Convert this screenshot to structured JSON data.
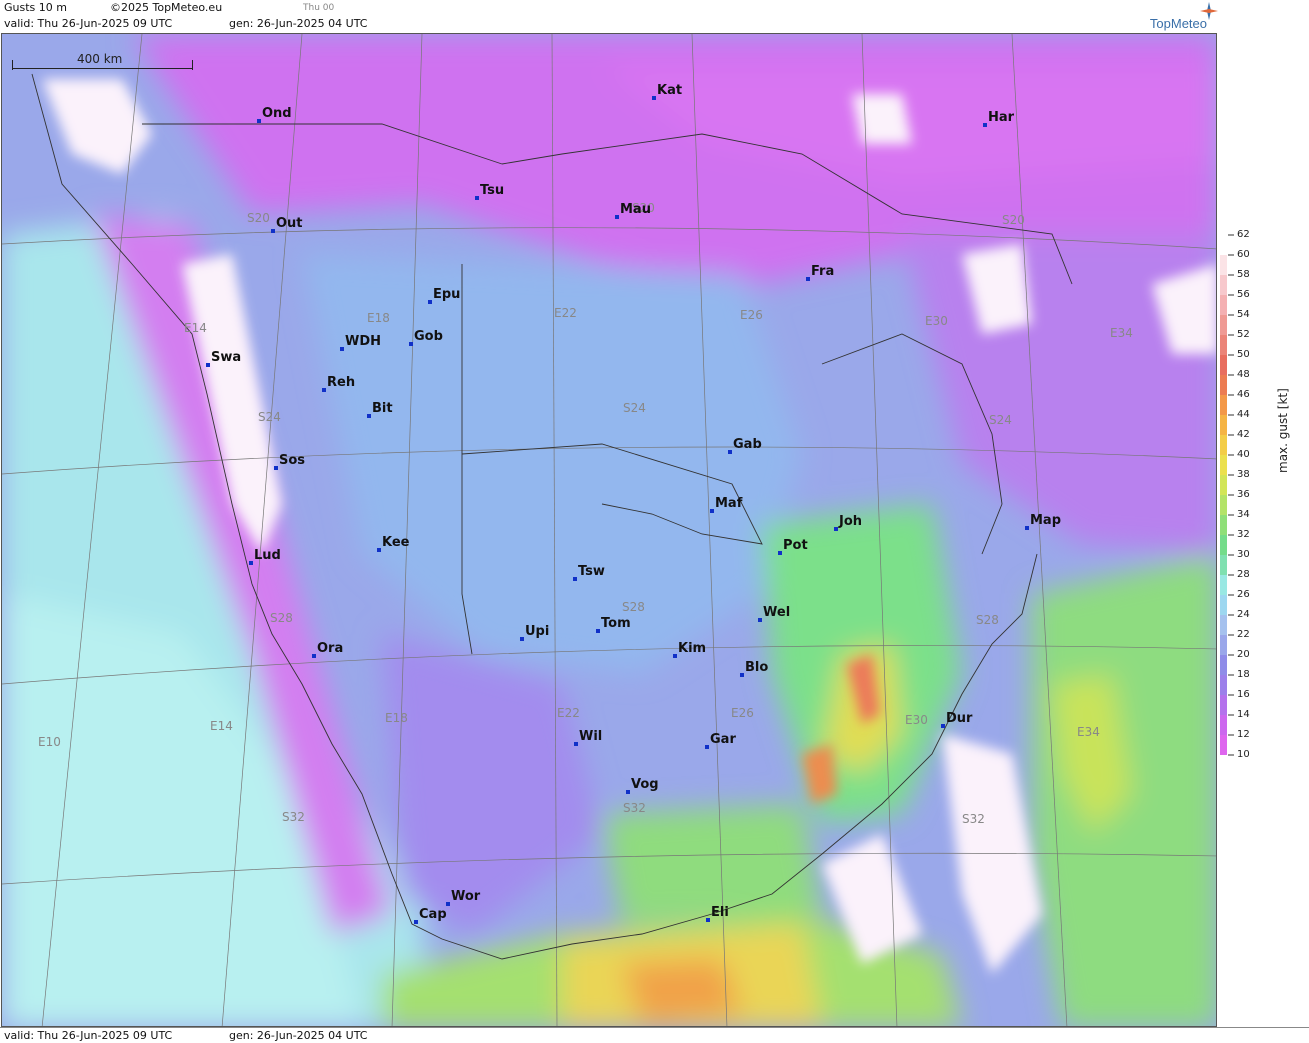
{
  "header": {
    "product": "Gusts 10 m",
    "copyright": "©2025 TopMeteo.eu",
    "run_hint": "Thu 00",
    "valid": "valid:  Thu  26-Jun-2025  09 UTC",
    "gen": "gen: 26-Jun-2025 04 UTC",
    "logo": "TopMeteo"
  },
  "footer": {
    "valid": "valid:  Thu  26-Jun-2025  09 UTC",
    "gen": "gen: 26-Jun-2025 04 UTC"
  },
  "scale_bar": {
    "label": "400 km"
  },
  "cities": [
    {
      "name": "Ond"
    },
    {
      "name": "Kat"
    },
    {
      "name": "Har"
    },
    {
      "name": "Tsu"
    },
    {
      "name": "Out"
    },
    {
      "name": "Mau"
    },
    {
      "name": "Fra"
    },
    {
      "name": "Epu"
    },
    {
      "name": "WDH"
    },
    {
      "name": "Gob"
    },
    {
      "name": "Swa"
    },
    {
      "name": "Reh"
    },
    {
      "name": "Bit"
    },
    {
      "name": "Gab"
    },
    {
      "name": "Sos"
    },
    {
      "name": "Maf"
    },
    {
      "name": "Joh"
    },
    {
      "name": "Map"
    },
    {
      "name": "Pot"
    },
    {
      "name": "Lud"
    },
    {
      "name": "Kee"
    },
    {
      "name": "Tsw"
    },
    {
      "name": "Wel"
    },
    {
      "name": "Tom"
    },
    {
      "name": "Upi"
    },
    {
      "name": "Ora"
    },
    {
      "name": "Kim"
    },
    {
      "name": "Blo"
    },
    {
      "name": "Dur"
    },
    {
      "name": "Wil"
    },
    {
      "name": "Gar"
    },
    {
      "name": "Vog"
    },
    {
      "name": "Wor"
    },
    {
      "name": "Cap"
    },
    {
      "name": "Eli"
    }
  ],
  "grid_labels": [
    {
      "text": "S20"
    },
    {
      "text": "S20"
    },
    {
      "text": "S20"
    },
    {
      "text": "E14"
    },
    {
      "text": "E18"
    },
    {
      "text": "E22"
    },
    {
      "text": "E26"
    },
    {
      "text": "E30"
    },
    {
      "text": "E34"
    },
    {
      "text": "S24"
    },
    {
      "text": "S24"
    },
    {
      "text": "S24"
    },
    {
      "text": "S28"
    },
    {
      "text": "S28"
    },
    {
      "text": "S28"
    },
    {
      "text": "E10"
    },
    {
      "text": "E14"
    },
    {
      "text": "E18"
    },
    {
      "text": "E22"
    },
    {
      "text": "E26"
    },
    {
      "text": "E30"
    },
    {
      "text": "E34"
    },
    {
      "text": "S32"
    },
    {
      "text": "S32"
    },
    {
      "text": "S32"
    }
  ],
  "legend": {
    "title": "max. gust  [kt]",
    "ticks": [
      "62",
      "60",
      "58",
      "56",
      "54",
      "52",
      "50",
      "48",
      "46",
      "44",
      "42",
      "40",
      "38",
      "36",
      "34",
      "32",
      "30",
      "28",
      "26",
      "24",
      "22",
      "20",
      "18",
      "16",
      "14",
      "12",
      "10"
    ],
    "colors": [
      "#ffffff",
      "#fbe3e6",
      "#f7c8cc",
      "#f4b0b2",
      "#ef9a94",
      "#eb8478",
      "#e86e5f",
      "#ec7c52",
      "#f39848",
      "#f5b444",
      "#f3cd48",
      "#ebe04e",
      "#d2e558",
      "#b3e368",
      "#8fdf78",
      "#74dc8a",
      "#7fe0b0",
      "#99e8e3",
      "#9dd7f0",
      "#a5c1ee",
      "#9aa7ea",
      "#8f8ce8",
      "#9c80ea",
      "#b472ec",
      "#cc68ee",
      "#de66ee"
    ]
  }
}
